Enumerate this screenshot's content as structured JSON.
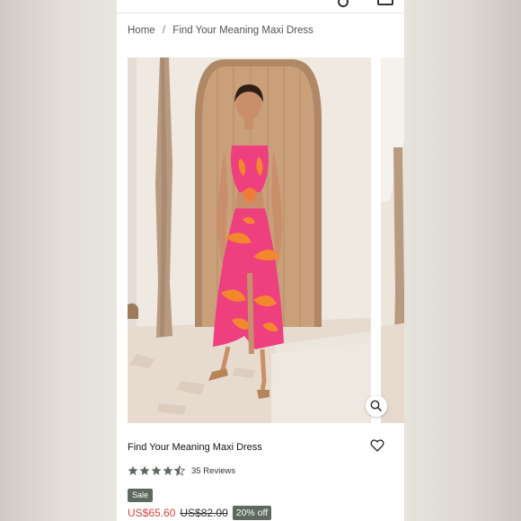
{
  "breadcrumb": {
    "home": "Home",
    "separator": "/",
    "current": "Find Your Meaning Maxi Dress"
  },
  "gallery": {
    "main_image": "product-photo",
    "next_image": "product-photo-next",
    "zoom_icon": "magnifier-icon"
  },
  "product": {
    "title": "Find Your Meaning Maxi Dress",
    "rating": 4.5,
    "reviews": "35 Reviews",
    "sale_label": "Sale",
    "price_now": "US$65.60",
    "price_was": "US$82.00",
    "discount": "20% off",
    "wishlist_icon": "heart-icon"
  },
  "colors": {
    "sale_price": "#d2463c",
    "badge": "#5e6a60",
    "stars": "#5e6a60"
  }
}
